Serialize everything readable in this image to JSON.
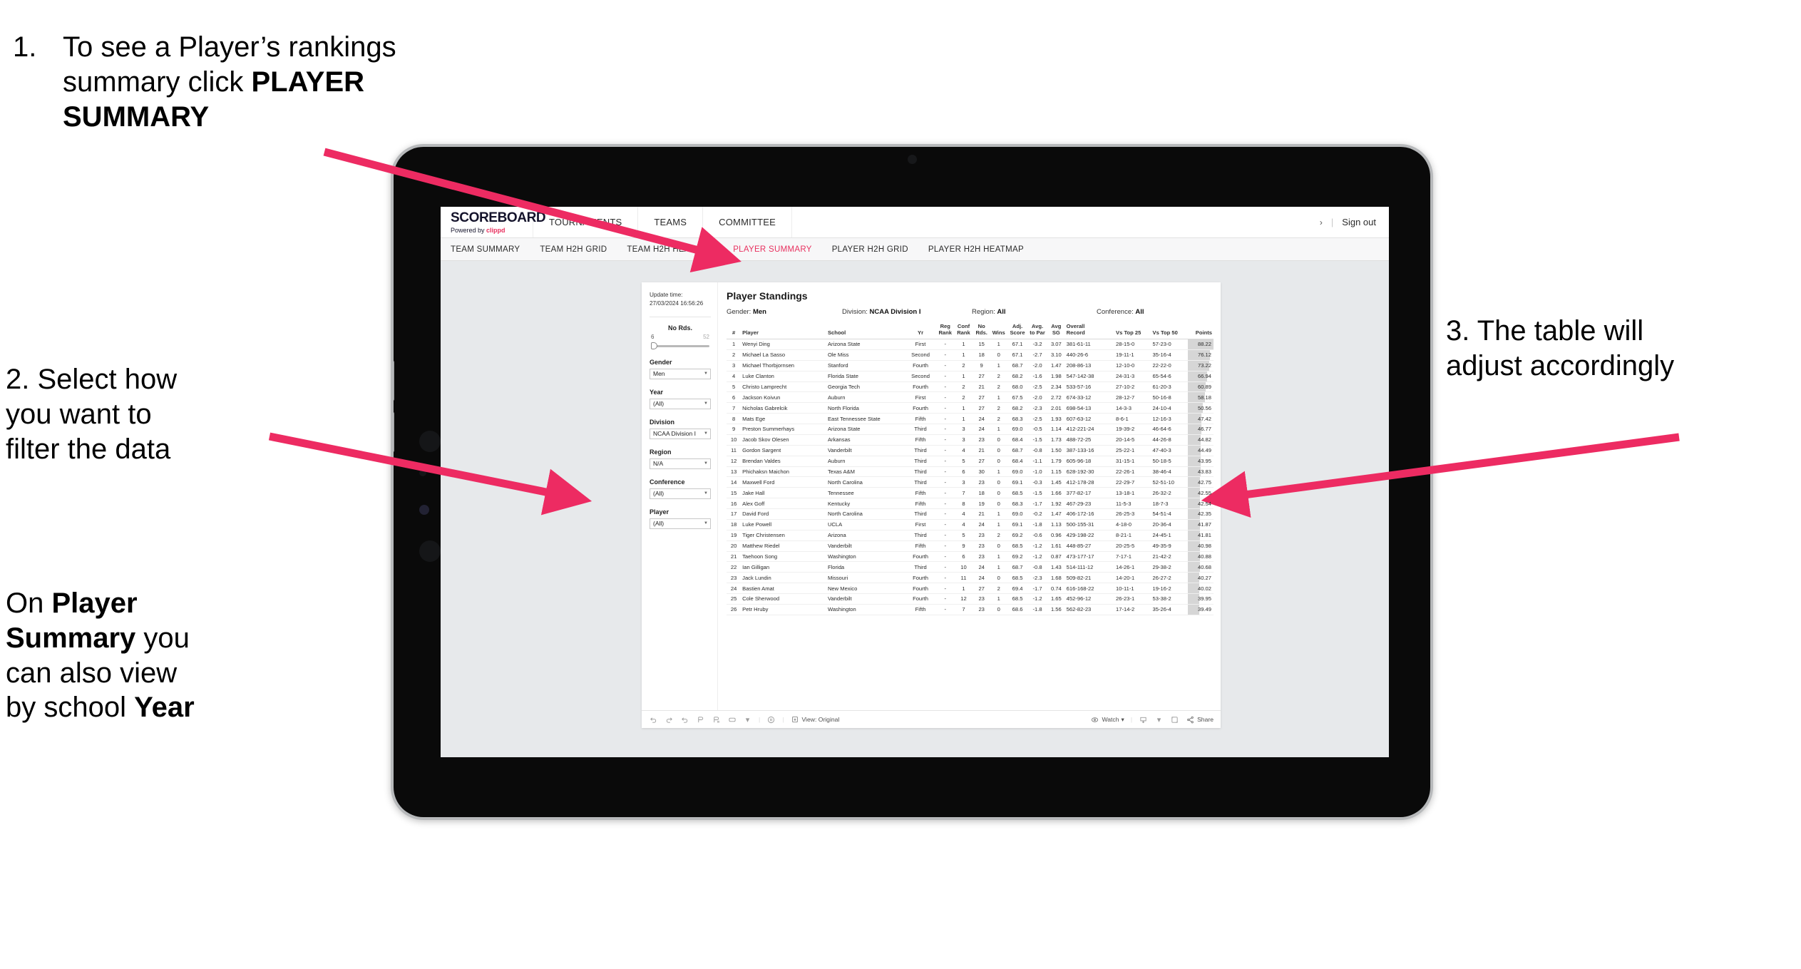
{
  "annotations": {
    "one": {
      "number": "1.",
      "line1": "To see a Player’s rankings",
      "line2_pre": "summary click ",
      "line2_bold": "PLAYER",
      "line3_bold": "SUMMARY"
    },
    "two": {
      "line1": "2. Select how",
      "line2": "you want to",
      "line3": "filter the data"
    },
    "two_b": {
      "pre": "On ",
      "bold1": "Player",
      "bold2": "Summary",
      "mid": " you",
      "line3": "can also view",
      "line4_pre": "by school ",
      "line4_bold": "Year"
    },
    "three": {
      "line1": "3. The table will",
      "line2": "adjust accordingly"
    },
    "arrow_color": "#ED2B62"
  },
  "app": {
    "brand": {
      "name": "SCOREBOARD",
      "powered_pre": "Powered by ",
      "powered_brand": "clippd"
    },
    "topnav": [
      "TOURNAMENTS",
      "TEAMS",
      "COMMITTEE"
    ],
    "topright": {
      "chevron": "›",
      "divider": "|",
      "signout": "Sign out"
    },
    "subnav": {
      "tabs": [
        "TEAM SUMMARY",
        "TEAM H2H GRID",
        "TEAM H2H HEATMAP",
        "PLAYER SUMMARY",
        "PLAYER H2H GRID",
        "PLAYER H2H HEATMAP"
      ],
      "active": "PLAYER SUMMARY",
      "active_color": "#E8315F"
    },
    "filters": {
      "update_label": "Update time:",
      "update_value": "27/03/2024 16:56:26",
      "slider": {
        "label": "No Rds.",
        "min": "6",
        "max": "52"
      },
      "selects": [
        {
          "label": "Gender",
          "value": "Men"
        },
        {
          "label": "Year",
          "value": "(All)"
        },
        {
          "label": "Division",
          "value": "NCAA Division I"
        },
        {
          "label": "Region",
          "value": "N/A"
        },
        {
          "label": "Conference",
          "value": "(All)"
        },
        {
          "label": "Player",
          "value": "(All)"
        }
      ]
    },
    "table": {
      "title": "Player Standings",
      "meta": [
        {
          "label": "Gender: ",
          "value": "Men"
        },
        {
          "label": "Division: ",
          "value": "NCAA Division I"
        },
        {
          "label": "Region: ",
          "value": "All"
        },
        {
          "label": "Conference: ",
          "value": "All"
        }
      ],
      "columns": [
        "#",
        "Player",
        "School",
        "Yr",
        "Reg Rank",
        "Conf Rank",
        "No Rds.",
        "Wins",
        "Adj. Score",
        "Avg. to Par",
        "Avg SG",
        "Overall Record",
        "Vs Top 25",
        "Vs Top 50",
        "Points"
      ]
    },
    "toolbar": {
      "view_label": "View: Original",
      "watch_label": "Watch",
      "share_label": "Share",
      "caret": "▾",
      "divider": "|"
    }
  },
  "chart_data": {
    "type": "table",
    "title": "Player Standings",
    "columns": [
      "#",
      "Player",
      "School",
      "Yr",
      "Reg Rank",
      "Conf Rank",
      "No Rds.",
      "Wins",
      "Adj. Score",
      "Avg. to Par",
      "Avg SG",
      "Overall Record",
      "Vs Top 25",
      "Vs Top 50",
      "Points"
    ],
    "rows": [
      [
        "1",
        "Wenyi Ding",
        "Arizona State",
        "First",
        "-",
        "1",
        "15",
        "1",
        "67.1",
        "-3.2",
        "3.07",
        "381-61-11",
        "28-15-0",
        "57-23-0",
        "88.22"
      ],
      [
        "2",
        "Michael La Sasso",
        "Ole Miss",
        "Second",
        "-",
        "1",
        "18",
        "0",
        "67.1",
        "-2.7",
        "3.10",
        "440-26-6",
        "19-11-1",
        "35-16-4",
        "76.12"
      ],
      [
        "3",
        "Michael Thorbjornsen",
        "Stanford",
        "Fourth",
        "-",
        "2",
        "9",
        "1",
        "68.7",
        "-2.0",
        "1.47",
        "208-86-13",
        "12-10-0",
        "22-22-0",
        "73.22"
      ],
      [
        "4",
        "Luke Clanton",
        "Florida State",
        "Second",
        "-",
        "1",
        "27",
        "2",
        "68.2",
        "-1.6",
        "1.98",
        "547-142-38",
        "24-31-3",
        "65-54-6",
        "66.94"
      ],
      [
        "5",
        "Christo Lamprecht",
        "Georgia Tech",
        "Fourth",
        "-",
        "2",
        "21",
        "2",
        "68.0",
        "-2.5",
        "2.34",
        "533-57-16",
        "27-10-2",
        "61-20-3",
        "60.89"
      ],
      [
        "6",
        "Jackson Koivun",
        "Auburn",
        "First",
        "-",
        "2",
        "27",
        "1",
        "67.5",
        "-2.0",
        "2.72",
        "674-33-12",
        "28-12-7",
        "50-16-8",
        "58.18"
      ],
      [
        "7",
        "Nicholas Gabrelcik",
        "North Florida",
        "Fourth",
        "-",
        "1",
        "27",
        "2",
        "68.2",
        "-2.3",
        "2.01",
        "698-54-13",
        "14-3-3",
        "24-10-4",
        "50.56"
      ],
      [
        "8",
        "Mats Ege",
        "East Tennessee State",
        "Fifth",
        "-",
        "1",
        "24",
        "2",
        "68.3",
        "-2.5",
        "1.93",
        "607-63-12",
        "8-6-1",
        "12-16-3",
        "47.42"
      ],
      [
        "9",
        "Preston Summerhays",
        "Arizona State",
        "Third",
        "-",
        "3",
        "24",
        "1",
        "69.0",
        "-0.5",
        "1.14",
        "412-221-24",
        "19-39-2",
        "46-64-6",
        "46.77"
      ],
      [
        "10",
        "Jacob Skov Olesen",
        "Arkansas",
        "Fifth",
        "-",
        "3",
        "23",
        "0",
        "68.4",
        "-1.5",
        "1.73",
        "488-72-25",
        "20-14-5",
        "44-26-8",
        "44.82"
      ],
      [
        "11",
        "Gordon Sargent",
        "Vanderbilt",
        "Third",
        "-",
        "4",
        "21",
        "0",
        "68.7",
        "-0.8",
        "1.50",
        "387-133-16",
        "25-22-1",
        "47-40-3",
        "44.49"
      ],
      [
        "12",
        "Brendan Valdes",
        "Auburn",
        "Third",
        "-",
        "5",
        "27",
        "0",
        "68.4",
        "-1.1",
        "1.79",
        "605-96-18",
        "31-15-1",
        "50-18-5",
        "43.95"
      ],
      [
        "13",
        "Phichaksn Maichon",
        "Texas A&M",
        "Third",
        "-",
        "6",
        "30",
        "1",
        "69.0",
        "-1.0",
        "1.15",
        "628-192-30",
        "22-26-1",
        "38-46-4",
        "43.83"
      ],
      [
        "14",
        "Maxwell Ford",
        "North Carolina",
        "Third",
        "-",
        "3",
        "23",
        "0",
        "69.1",
        "-0.3",
        "1.45",
        "412-178-28",
        "22-29-7",
        "52-51-10",
        "42.75"
      ],
      [
        "15",
        "Jake Hall",
        "Tennessee",
        "Fifth",
        "-",
        "7",
        "18",
        "0",
        "68.5",
        "-1.5",
        "1.66",
        "377-82-17",
        "13-18-1",
        "26-32-2",
        "42.55"
      ],
      [
        "16",
        "Alex Goff",
        "Kentucky",
        "Fifth",
        "-",
        "8",
        "19",
        "0",
        "68.3",
        "-1.7",
        "1.92",
        "467-29-23",
        "11-5-3",
        "18-7-3",
        "42.54"
      ],
      [
        "17",
        "David Ford",
        "North Carolina",
        "Third",
        "-",
        "4",
        "21",
        "1",
        "69.0",
        "-0.2",
        "1.47",
        "406-172-16",
        "26-25-3",
        "54-51-4",
        "42.35"
      ],
      [
        "18",
        "Luke Powell",
        "UCLA",
        "First",
        "-",
        "4",
        "24",
        "1",
        "69.1",
        "-1.8",
        "1.13",
        "500-155-31",
        "4-18-0",
        "20-36-4",
        "41.87"
      ],
      [
        "19",
        "Tiger Christensen",
        "Arizona",
        "Third",
        "-",
        "5",
        "23",
        "2",
        "69.2",
        "-0.6",
        "0.96",
        "429-198-22",
        "8-21-1",
        "24-45-1",
        "41.81"
      ],
      [
        "20",
        "Matthew Riedel",
        "Vanderbilt",
        "Fifth",
        "-",
        "9",
        "23",
        "0",
        "68.5",
        "-1.2",
        "1.61",
        "448-85-27",
        "20-25-5",
        "49-35-9",
        "40.98"
      ],
      [
        "21",
        "Taehoon Song",
        "Washington",
        "Fourth",
        "-",
        "6",
        "23",
        "1",
        "69.2",
        "-1.2",
        "0.87",
        "473-177-17",
        "7-17-1",
        "21-42-2",
        "40.88"
      ],
      [
        "22",
        "Ian Gilligan",
        "Florida",
        "Third",
        "-",
        "10",
        "24",
        "1",
        "68.7",
        "-0.8",
        "1.43",
        "514-111-12",
        "14-26-1",
        "29-38-2",
        "40.68"
      ],
      [
        "23",
        "Jack Lundin",
        "Missouri",
        "Fourth",
        "-",
        "11",
        "24",
        "0",
        "68.5",
        "-2.3",
        "1.68",
        "509-82-21",
        "14-20-1",
        "26-27-2",
        "40.27"
      ],
      [
        "24",
        "Bastien Amat",
        "New Mexico",
        "Fourth",
        "-",
        "1",
        "27",
        "2",
        "69.4",
        "-1.7",
        "0.74",
        "616-168-22",
        "10-11-1",
        "19-16-2",
        "40.02"
      ],
      [
        "25",
        "Cole Sherwood",
        "Vanderbilt",
        "Fourth",
        "-",
        "12",
        "23",
        "1",
        "68.5",
        "-1.2",
        "1.65",
        "452-96-12",
        "26-23-1",
        "53-38-2",
        "39.95"
      ],
      [
        "26",
        "Petr Hruby",
        "Washington",
        "Fifth",
        "-",
        "7",
        "23",
        "0",
        "68.6",
        "-1.8",
        "1.56",
        "562-82-23",
        "17-14-2",
        "35-26-4",
        "39.49"
      ]
    ],
    "points_max": 88.22,
    "points_column": "Points"
  }
}
